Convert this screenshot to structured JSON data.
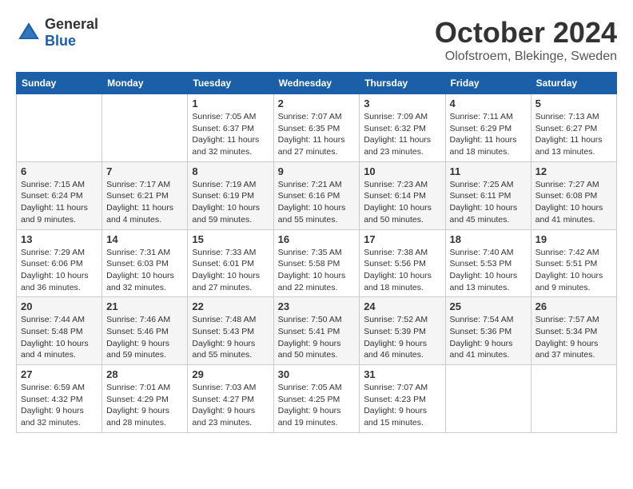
{
  "header": {
    "logo": {
      "general": "General",
      "blue": "Blue"
    },
    "month": "October 2024",
    "location": "Olofstroem, Blekinge, Sweden"
  },
  "weekdays": [
    "Sunday",
    "Monday",
    "Tuesday",
    "Wednesday",
    "Thursday",
    "Friday",
    "Saturday"
  ],
  "weeks": [
    [
      {
        "day": "",
        "sunrise": "",
        "sunset": "",
        "daylight": ""
      },
      {
        "day": "",
        "sunrise": "",
        "sunset": "",
        "daylight": ""
      },
      {
        "day": "1",
        "sunrise": "Sunrise: 7:05 AM",
        "sunset": "Sunset: 6:37 PM",
        "daylight": "Daylight: 11 hours and 32 minutes."
      },
      {
        "day": "2",
        "sunrise": "Sunrise: 7:07 AM",
        "sunset": "Sunset: 6:35 PM",
        "daylight": "Daylight: 11 hours and 27 minutes."
      },
      {
        "day": "3",
        "sunrise": "Sunrise: 7:09 AM",
        "sunset": "Sunset: 6:32 PM",
        "daylight": "Daylight: 11 hours and 23 minutes."
      },
      {
        "day": "4",
        "sunrise": "Sunrise: 7:11 AM",
        "sunset": "Sunset: 6:29 PM",
        "daylight": "Daylight: 11 hours and 18 minutes."
      },
      {
        "day": "5",
        "sunrise": "Sunrise: 7:13 AM",
        "sunset": "Sunset: 6:27 PM",
        "daylight": "Daylight: 11 hours and 13 minutes."
      }
    ],
    [
      {
        "day": "6",
        "sunrise": "Sunrise: 7:15 AM",
        "sunset": "Sunset: 6:24 PM",
        "daylight": "Daylight: 11 hours and 9 minutes."
      },
      {
        "day": "7",
        "sunrise": "Sunrise: 7:17 AM",
        "sunset": "Sunset: 6:21 PM",
        "daylight": "Daylight: 11 hours and 4 minutes."
      },
      {
        "day": "8",
        "sunrise": "Sunrise: 7:19 AM",
        "sunset": "Sunset: 6:19 PM",
        "daylight": "Daylight: 10 hours and 59 minutes."
      },
      {
        "day": "9",
        "sunrise": "Sunrise: 7:21 AM",
        "sunset": "Sunset: 6:16 PM",
        "daylight": "Daylight: 10 hours and 55 minutes."
      },
      {
        "day": "10",
        "sunrise": "Sunrise: 7:23 AM",
        "sunset": "Sunset: 6:14 PM",
        "daylight": "Daylight: 10 hours and 50 minutes."
      },
      {
        "day": "11",
        "sunrise": "Sunrise: 7:25 AM",
        "sunset": "Sunset: 6:11 PM",
        "daylight": "Daylight: 10 hours and 45 minutes."
      },
      {
        "day": "12",
        "sunrise": "Sunrise: 7:27 AM",
        "sunset": "Sunset: 6:08 PM",
        "daylight": "Daylight: 10 hours and 41 minutes."
      }
    ],
    [
      {
        "day": "13",
        "sunrise": "Sunrise: 7:29 AM",
        "sunset": "Sunset: 6:06 PM",
        "daylight": "Daylight: 10 hours and 36 minutes."
      },
      {
        "day": "14",
        "sunrise": "Sunrise: 7:31 AM",
        "sunset": "Sunset: 6:03 PM",
        "daylight": "Daylight: 10 hours and 32 minutes."
      },
      {
        "day": "15",
        "sunrise": "Sunrise: 7:33 AM",
        "sunset": "Sunset: 6:01 PM",
        "daylight": "Daylight: 10 hours and 27 minutes."
      },
      {
        "day": "16",
        "sunrise": "Sunrise: 7:35 AM",
        "sunset": "Sunset: 5:58 PM",
        "daylight": "Daylight: 10 hours and 22 minutes."
      },
      {
        "day": "17",
        "sunrise": "Sunrise: 7:38 AM",
        "sunset": "Sunset: 5:56 PM",
        "daylight": "Daylight: 10 hours and 18 minutes."
      },
      {
        "day": "18",
        "sunrise": "Sunrise: 7:40 AM",
        "sunset": "Sunset: 5:53 PM",
        "daylight": "Daylight: 10 hours and 13 minutes."
      },
      {
        "day": "19",
        "sunrise": "Sunrise: 7:42 AM",
        "sunset": "Sunset: 5:51 PM",
        "daylight": "Daylight: 10 hours and 9 minutes."
      }
    ],
    [
      {
        "day": "20",
        "sunrise": "Sunrise: 7:44 AM",
        "sunset": "Sunset: 5:48 PM",
        "daylight": "Daylight: 10 hours and 4 minutes."
      },
      {
        "day": "21",
        "sunrise": "Sunrise: 7:46 AM",
        "sunset": "Sunset: 5:46 PM",
        "daylight": "Daylight: 9 hours and 59 minutes."
      },
      {
        "day": "22",
        "sunrise": "Sunrise: 7:48 AM",
        "sunset": "Sunset: 5:43 PM",
        "daylight": "Daylight: 9 hours and 55 minutes."
      },
      {
        "day": "23",
        "sunrise": "Sunrise: 7:50 AM",
        "sunset": "Sunset: 5:41 PM",
        "daylight": "Daylight: 9 hours and 50 minutes."
      },
      {
        "day": "24",
        "sunrise": "Sunrise: 7:52 AM",
        "sunset": "Sunset: 5:39 PM",
        "daylight": "Daylight: 9 hours and 46 minutes."
      },
      {
        "day": "25",
        "sunrise": "Sunrise: 7:54 AM",
        "sunset": "Sunset: 5:36 PM",
        "daylight": "Daylight: 9 hours and 41 minutes."
      },
      {
        "day": "26",
        "sunrise": "Sunrise: 7:57 AM",
        "sunset": "Sunset: 5:34 PM",
        "daylight": "Daylight: 9 hours and 37 minutes."
      }
    ],
    [
      {
        "day": "27",
        "sunrise": "Sunrise: 6:59 AM",
        "sunset": "Sunset: 4:32 PM",
        "daylight": "Daylight: 9 hours and 32 minutes."
      },
      {
        "day": "28",
        "sunrise": "Sunrise: 7:01 AM",
        "sunset": "Sunset: 4:29 PM",
        "daylight": "Daylight: 9 hours and 28 minutes."
      },
      {
        "day": "29",
        "sunrise": "Sunrise: 7:03 AM",
        "sunset": "Sunset: 4:27 PM",
        "daylight": "Daylight: 9 hours and 23 minutes."
      },
      {
        "day": "30",
        "sunrise": "Sunrise: 7:05 AM",
        "sunset": "Sunset: 4:25 PM",
        "daylight": "Daylight: 9 hours and 19 minutes."
      },
      {
        "day": "31",
        "sunrise": "Sunrise: 7:07 AM",
        "sunset": "Sunset: 4:23 PM",
        "daylight": "Daylight: 9 hours and 15 minutes."
      },
      {
        "day": "",
        "sunrise": "",
        "sunset": "",
        "daylight": ""
      },
      {
        "day": "",
        "sunrise": "",
        "sunset": "",
        "daylight": ""
      }
    ]
  ]
}
